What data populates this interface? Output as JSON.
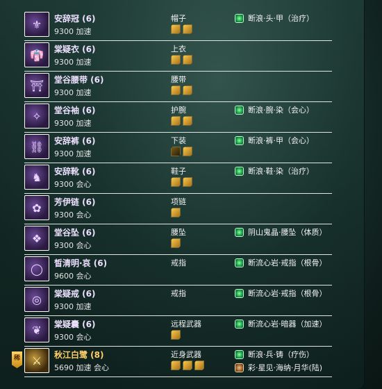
{
  "items": [
    {
      "name": "安辞冠 (6)",
      "attr": "9300 加速",
      "slot": "帽子",
      "stones": [
        "gold",
        "gold"
      ],
      "enchants": [
        {
          "icon": "green",
          "text": "断浪·头·甲（治疗）"
        }
      ],
      "tier": "purple",
      "icon": "helmet-icon",
      "glyph": "⚜"
    },
    {
      "name": "棠疑衣 (6)",
      "attr": "9300 加速",
      "slot": "上衣",
      "stones": [
        "gold",
        "gold"
      ],
      "enchants": [],
      "tier": "purple",
      "icon": "robe-icon",
      "glyph": "👘"
    },
    {
      "name": "堂谷腰带 (6)",
      "attr": "9300 加速",
      "slot": "腰带",
      "stones": [
        "gold",
        "gold"
      ],
      "enchants": [],
      "tier": "purple",
      "icon": "belt-icon",
      "glyph": "⛩"
    },
    {
      "name": "堂谷袖 (6)",
      "attr": "9300 加速",
      "slot": "护腕",
      "stones": [
        "gold",
        "gold"
      ],
      "enchants": [
        {
          "icon": "green",
          "text": "断浪·腕·染（会心）"
        }
      ],
      "tier": "purple",
      "icon": "bracer-icon",
      "glyph": "✧"
    },
    {
      "name": "安辞裤 (6)",
      "attr": "9300 加速",
      "slot": "下装",
      "stones": [
        "dark",
        "gold"
      ],
      "enchants": [
        {
          "icon": "green",
          "text": "断浪·裤·甲（会心）"
        }
      ],
      "tier": "purple",
      "icon": "pants-icon",
      "glyph": "⛓"
    },
    {
      "name": "安辞靴 (6)",
      "attr": "9300 会心",
      "slot": "鞋子",
      "stones": [
        "gold",
        "gold"
      ],
      "enchants": [
        {
          "icon": "green",
          "text": "断浪·鞋·染（治疗）"
        }
      ],
      "tier": "purple",
      "icon": "boots-icon",
      "glyph": "♞"
    },
    {
      "name": "芳伊链 (6)",
      "attr": "9300 会心",
      "slot": "项链",
      "stones": [
        "gold"
      ],
      "enchants": [],
      "tier": "purple",
      "icon": "necklace-icon",
      "glyph": "✿"
    },
    {
      "name": "堂谷坠 (6)",
      "attr": "9300 会心",
      "slot": "腰坠",
      "stones": [
        "gold"
      ],
      "enchants": [
        {
          "icon": "green",
          "text": "阴山鬼晶·腰坠（体质）"
        }
      ],
      "tier": "purple",
      "icon": "pendant-icon",
      "glyph": "❖"
    },
    {
      "name": "皙清明·哀 (6)",
      "attr": "9600 会心",
      "slot": "戒指",
      "stones": [],
      "enchants": [
        {
          "icon": "green",
          "text": "断流心岩·戒指（根骨）"
        }
      ],
      "tier": "purple",
      "icon": "ring-jade-icon",
      "glyph": "◯"
    },
    {
      "name": "棠疑戒 (6)",
      "attr": "9300 加速",
      "slot": "戒指",
      "stones": [],
      "enchants": [
        {
          "icon": "green",
          "text": "断流心岩·戒指（根骨）"
        }
      ],
      "tier": "purple",
      "icon": "ring-gold-icon",
      "glyph": "◎"
    },
    {
      "name": "棠疑囊 (6)",
      "attr": "9300 会心",
      "slot": "远程武器",
      "stones": [
        "gold"
      ],
      "enchants": [
        {
          "icon": "green",
          "text": "断流心岩·暗器（加速）"
        }
      ],
      "tier": "purple",
      "icon": "pouch-icon",
      "glyph": "❦"
    },
    {
      "name": "秋江白鹭 (8)",
      "attr": "5690 加速 会心",
      "slot": "近身武器",
      "stones": [
        "gold",
        "gold",
        "gold"
      ],
      "enchants": [
        {
          "icon": "green",
          "text": "断浪·兵·铸（疗伤）"
        },
        {
          "icon": "figure",
          "text": "彩·星见·海纳·月华(陆)"
        }
      ],
      "tier": "gold",
      "icon": "weapon-icon",
      "glyph": "⚔"
    }
  ],
  "badge": {
    "text": "稀",
    "icon": "rare-badge-icon"
  }
}
